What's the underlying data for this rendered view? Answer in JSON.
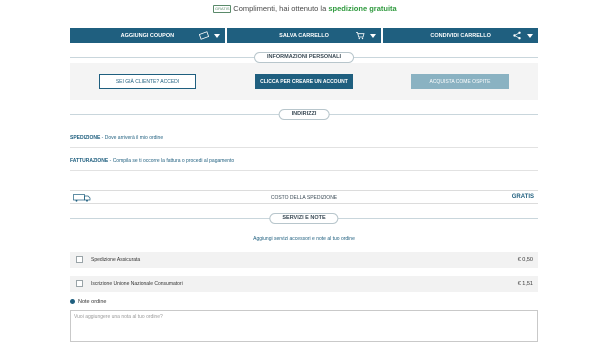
{
  "promo": {
    "badge": "GRATIS",
    "text": "Complimenti, hai ottenuto la ",
    "highlight": "spedizione gratuita"
  },
  "actions": [
    {
      "label": "AGGIUNGI COUPON",
      "icon": "coupon-icon"
    },
    {
      "label": "SALVA CARRELLO",
      "icon": "cart-icon"
    },
    {
      "label": "CONDIVIDI CARRELLO",
      "icon": "share-icon"
    }
  ],
  "personal": {
    "title": "INFORMAZIONI PERSONALI",
    "login_label": "SEI GIÀ CLIENTE? ACCEDI",
    "create_label": "CLICCA PER CREARE UN ACCOUNT",
    "guest_label": "ACQUISTA COME OSPITE"
  },
  "addresses": {
    "title": "INDIRIZZI",
    "shipping_bold": "SPEDIZIONE",
    "shipping_text": " - Dove arriverà il mio ordine",
    "billing_bold": "FATTURAZIONE",
    "billing_text": " - Compila se ti occorre la fattura o procedi al pagamento"
  },
  "shipping_cost": {
    "label": "COSTO DELLA SPEDIZIONE",
    "value": "GRATIS"
  },
  "services": {
    "title": "SERVIZI E NOTE",
    "subtitle": "Aggiungi servizi accessori e note al tuo ordine",
    "items": [
      {
        "name": "Spedizione Assicurata",
        "price": "€ 0,50"
      },
      {
        "name": "Iscrizione Unione Nazionale Consumatori",
        "price": "€ 1,51"
      }
    ]
  },
  "notes": {
    "label": "Note ordine",
    "placeholder": "Vuoi aggiungere una nota al tuo ordine?"
  },
  "colors": {
    "primary": "#1f5f7f",
    "accent_green": "#2f9a3e"
  }
}
